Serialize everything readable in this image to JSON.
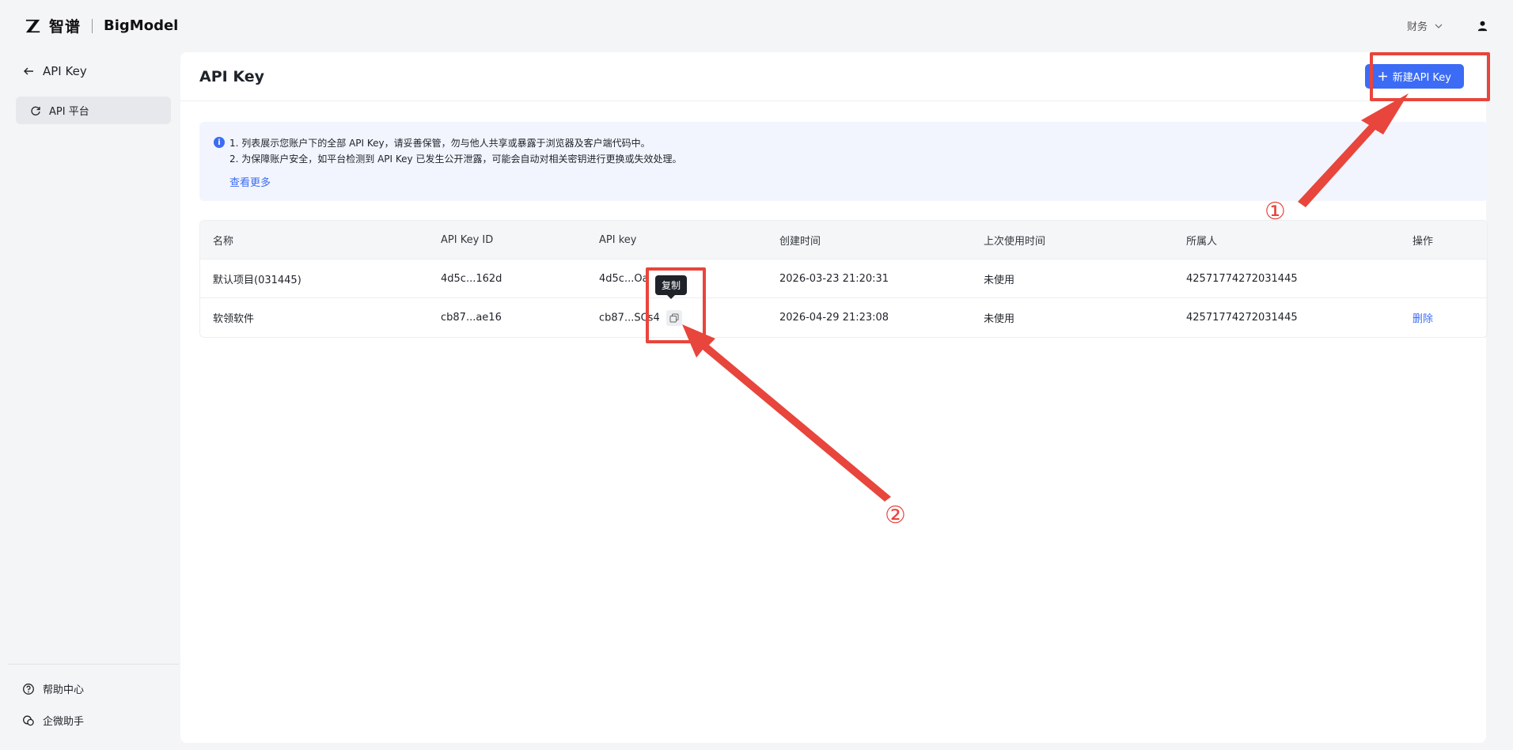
{
  "header": {
    "logo_cn": "智谱",
    "logo_en": "BigModel",
    "finance_label": "财务"
  },
  "sidebar": {
    "back_label": "API Key",
    "active_item": "API 平台",
    "footer": [
      {
        "label": "帮助中心",
        "icon": "help-circle-icon"
      },
      {
        "label": "企微助手",
        "icon": "chat-assistant-icon"
      }
    ]
  },
  "main": {
    "title": "API Key",
    "new_button_label": "新建API Key",
    "notice": {
      "line1": "1. 列表展示您账户下的全部 API Key，请妥善保管，勿与他人共享或暴露于浏览器及客户端代码中。",
      "line2": "2. 为保障账户安全，如平台检测到 API Key 已发生公开泄露，可能会自动对相关密钥进行更换或失效处理。",
      "more_link": "查看更多"
    },
    "table": {
      "columns": [
        "名称",
        "API Key ID",
        "API key",
        "创建时间",
        "上次使用时间",
        "所属人",
        "操作"
      ],
      "rows": [
        {
          "name": "默认项目(031445)",
          "key_id": "4d5c...162d",
          "key": "4d5c...Oa",
          "created": "2026-03-23 21:20:31",
          "last_used": "未使用",
          "owner": "425717742720314​45",
          "action": ""
        },
        {
          "name": "软领软件",
          "key_id": "cb87...ae16",
          "key": "cb87...SCs4",
          "created": "2026-04-29 21:23:08",
          "last_used": "未使用",
          "owner": "42571774272031445",
          "action": "删除"
        }
      ]
    },
    "tooltip": "复制"
  },
  "annotations": {
    "one": "①",
    "two": "②",
    "color": "#e8453c"
  },
  "colors": {
    "accent": "#3c6cf5",
    "notice_bg": "#f2f5fd"
  }
}
